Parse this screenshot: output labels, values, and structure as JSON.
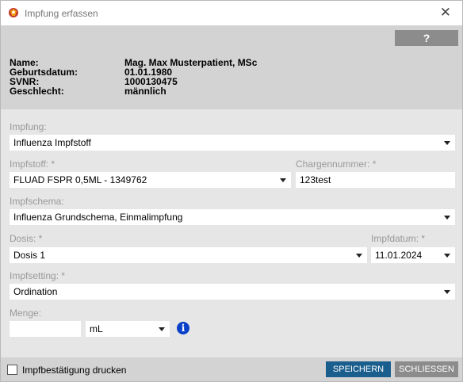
{
  "window": {
    "title": "Impfung erfassen",
    "title_icon": "app-logo-icon",
    "close_icon": "close-icon"
  },
  "header": {
    "help_label": "?",
    "patient": [
      {
        "label": "Name:",
        "value": "Mag. Max Musterpatient, MSc"
      },
      {
        "label": "Geburtsdatum:",
        "value": "01.01.1980"
      },
      {
        "label": "SVNR:",
        "value": "1000130475"
      },
      {
        "label": "Geschlecht:",
        "value": "männlich"
      }
    ]
  },
  "form": {
    "impfung": {
      "label": "Impfung:",
      "value": "Influenza Impfstoff"
    },
    "impfstoff": {
      "label": "Impfstoff: *",
      "value": "FLUAD FSPR 0,5ML - 1349762"
    },
    "chargennummer": {
      "label": "Chargennummer: *",
      "value": "123test"
    },
    "impfschema": {
      "label": "Impfschema:",
      "value": "Influenza Grundschema, Einmalimpfung"
    },
    "dosis": {
      "label": "Dosis: *",
      "value": "Dosis 1"
    },
    "impfdatum": {
      "label": "Impfdatum: *",
      "value": "11.01.2024"
    },
    "impfsetting": {
      "label": "Impfsetting: *",
      "value": "Ordination"
    },
    "menge": {
      "label": "Menge:",
      "value": "",
      "unit": "mL"
    },
    "info_icon": "info-icon"
  },
  "footer": {
    "checkbox_label": "Impfbestätigung drucken",
    "checked": false,
    "save_label": "SPEICHERN",
    "close_label": "SCHLIESSEN"
  },
  "colors": {
    "primary_button": "#1a5e8e",
    "secondary_button": "#8c8c8c",
    "info": "#0b40c8"
  }
}
